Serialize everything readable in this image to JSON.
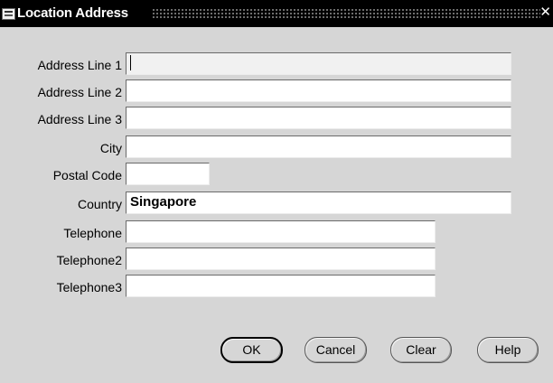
{
  "window": {
    "title": "Location Address"
  },
  "form": {
    "fields": [
      {
        "label": "Address Line 1",
        "value": ""
      },
      {
        "label": "Address Line 2",
        "value": ""
      },
      {
        "label": "Address Line 3",
        "value": ""
      },
      {
        "label": "City",
        "value": ""
      },
      {
        "label": "Postal Code",
        "value": ""
      },
      {
        "label": "Country",
        "value": "Singapore"
      },
      {
        "label": "Telephone",
        "value": ""
      },
      {
        "label": "Telephone2",
        "value": ""
      },
      {
        "label": "Telephone3",
        "value": ""
      }
    ]
  },
  "buttons": {
    "ok": "OK",
    "cancel": "Cancel",
    "clear": "Clear",
    "help": "Help"
  },
  "icons": {
    "app": "oracle-app-icon",
    "close": "close-icon"
  }
}
